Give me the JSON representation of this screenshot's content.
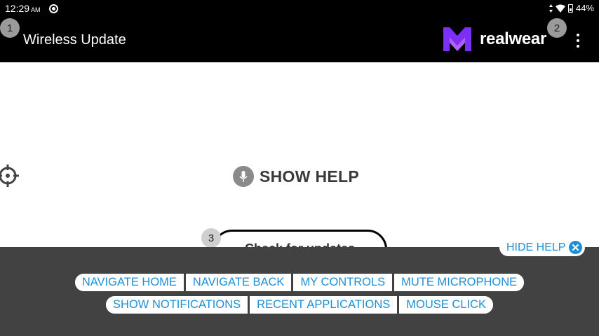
{
  "status_bar": {
    "time": "12:29",
    "ampm": "AM",
    "battery": "44%",
    "icons": [
      "recording-icon",
      "data-arrows-icon",
      "wifi-icon",
      "battery-icon"
    ]
  },
  "app_bar": {
    "title": "Wireless Update",
    "logo_text": "realwear",
    "logo_color": "#7b2ff7"
  },
  "badges": [
    "1",
    "2",
    "3"
  ],
  "content": {
    "show_help_label": "SHOW HELP",
    "update_button_label": "Check for updates"
  },
  "help_panel": {
    "hide_help_label": "HIDE HELP",
    "commands_row1": [
      "NAVIGATE HOME",
      "NAVIGATE BACK",
      "MY CONTROLS",
      "MUTE MICROPHONE"
    ],
    "commands_row2": [
      "SHOW NOTIFICATIONS",
      "RECENT APPLICATIONS",
      "MOUSE CLICK"
    ],
    "command_color": "#1d8fd6",
    "panel_color": "#424242"
  }
}
